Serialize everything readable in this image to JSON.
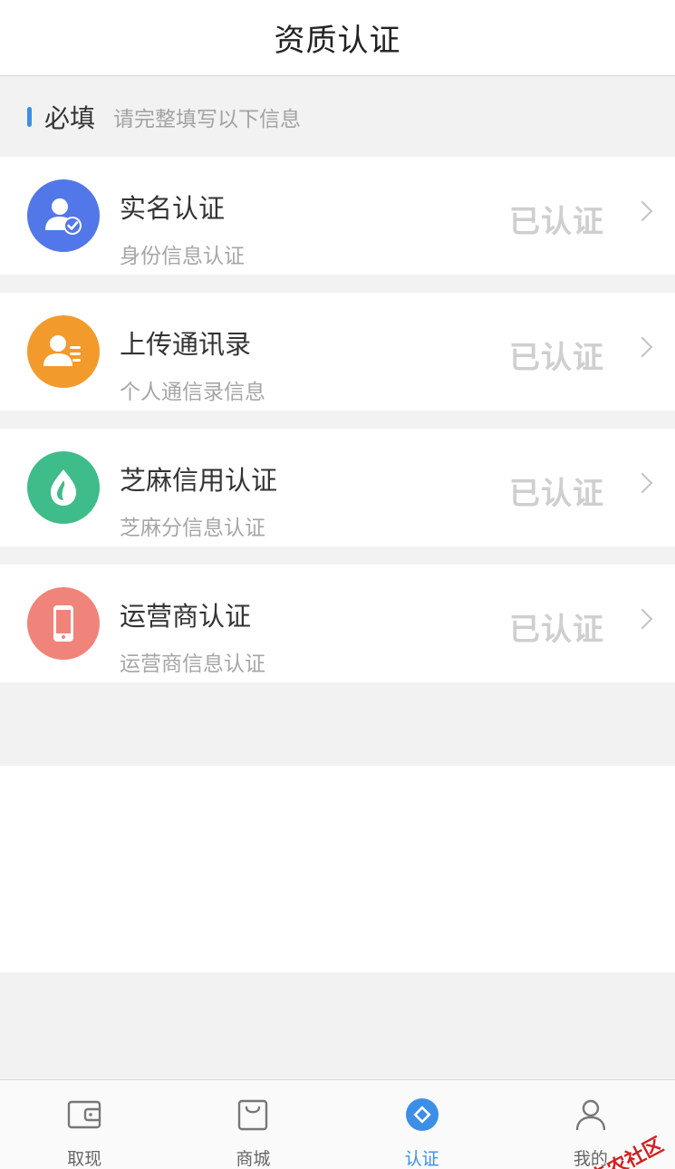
{
  "header": {
    "title": "资质认证"
  },
  "section": {
    "title": "必填",
    "subtitle": "请完整填写以下信息"
  },
  "certs": [
    {
      "title": "实名认证",
      "subtitle": "身份信息认证",
      "status": "已认证",
      "icon": "user-check-icon",
      "color": "#5277e8"
    },
    {
      "title": "上传通讯录",
      "subtitle": "个人通信录信息",
      "status": "已认证",
      "icon": "contact-card-icon",
      "color": "#f39a2c"
    },
    {
      "title": "芝麻信用认证",
      "subtitle": "芝麻分信息认证",
      "status": "已认证",
      "icon": "sesame-drop-icon",
      "color": "#3ebc8a"
    },
    {
      "title": "运营商认证",
      "subtitle": "运营商信息认证",
      "status": "已认证",
      "icon": "phone-icon",
      "color": "#f0837a"
    }
  ],
  "tabs": [
    {
      "label": "取现",
      "icon": "wallet-icon"
    },
    {
      "label": "商城",
      "icon": "shopping-bag-icon"
    },
    {
      "label": "认证",
      "icon": "certify-icon",
      "active": true
    },
    {
      "label": "我的",
      "icon": "person-icon"
    }
  ],
  "watermark": {
    "text": "卡农社区"
  },
  "colors": {
    "accent": "#3c8fe6",
    "status_gray": "#cfcfcf"
  }
}
